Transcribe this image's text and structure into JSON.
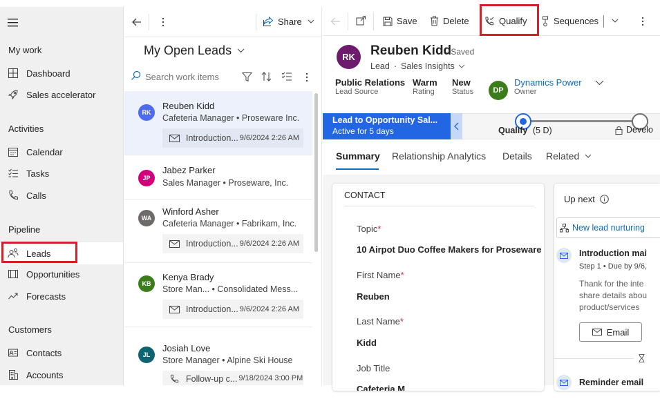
{
  "nav": {
    "sections": [
      {
        "title": "My work",
        "items": [
          {
            "label": "Dashboard",
            "icon": "dashboard-icon"
          },
          {
            "label": "Sales accelerator",
            "icon": "rocket-icon"
          }
        ]
      },
      {
        "title": "Activities",
        "items": [
          {
            "label": "Calendar",
            "icon": "calendar-icon"
          },
          {
            "label": "Tasks",
            "icon": "tasks-icon"
          },
          {
            "label": "Calls",
            "icon": "phone-icon"
          }
        ]
      },
      {
        "title": "Pipeline",
        "items": [
          {
            "label": "Leads",
            "icon": "leads-icon"
          },
          {
            "label": "Opportunities",
            "icon": "opportunities-icon"
          },
          {
            "label": "Forecasts",
            "icon": "forecast-icon"
          }
        ]
      },
      {
        "title": "Customers",
        "items": [
          {
            "label": "Contacts",
            "icon": "contact-card-icon"
          },
          {
            "label": "Accounts",
            "icon": "building-icon"
          }
        ]
      }
    ]
  },
  "list": {
    "share_label": "Share",
    "view_title": "My Open Leads",
    "search_placeholder": "Search work items",
    "leads": [
      {
        "initials": "RK",
        "color": "#4f6bed",
        "name": "Reuben Kidd",
        "subtitle": "Cafeteria Manager • Proseware Inc.",
        "activity_icon": "mail-icon",
        "activity": "Introduction...",
        "date": "9/6/2024 2:26 AM",
        "selected": true
      },
      {
        "initials": "JP",
        "color": "#d1007a",
        "name": "Jabez Parker",
        "subtitle": "Sales Manager • Proseware, Inc.",
        "activity": "",
        "date": ""
      },
      {
        "initials": "WA",
        "color": "#6e6a6a",
        "name": "Winford Asher",
        "subtitle": "Cafeteria Manager • Fabrikam, Inc.",
        "activity_icon": "mail-icon",
        "activity": "Introduction...",
        "date": "9/6/2024 2:26 AM"
      },
      {
        "initials": "KB",
        "color": "#3b7d1b",
        "name": "Kenya Brady",
        "subtitle": "Store Man...   • Consolidated Mess...",
        "activity_icon": "mail-icon",
        "activity": "Introduction...",
        "date": "9/6/2024 2:26 AM"
      },
      {
        "initials": "JL",
        "color": "#0e6472",
        "name": "Josiah Love",
        "subtitle": "Store Manager • Alpine Ski House",
        "activity_icon": "phone-icon",
        "activity": "Follow-up c...",
        "date": "9/18/2024 3:00 PM"
      }
    ]
  },
  "toolbar": {
    "save": "Save",
    "delete": "Delete",
    "qualify": "Qualify",
    "sequences": "Sequences"
  },
  "record": {
    "initials": "RK",
    "avatar_color": "#6e1b6e",
    "name": "Reuben Kidd",
    "saved": "- Saved",
    "entity": "Lead",
    "form": "Sales Insights",
    "fields": [
      {
        "value": "Public Relations",
        "label": "Lead Source"
      },
      {
        "value": "Warm",
        "label": "Rating"
      },
      {
        "value": "New",
        "label": "Status"
      }
    ],
    "owner": {
      "initials": "DP",
      "color": "#3b7d1b",
      "name": "Dynamics Power",
      "label": "Owner"
    }
  },
  "bpf": {
    "title": "Lead to Opportunity Sal...",
    "subtitle": "Active for 5 days",
    "stage1": "Qualify",
    "stage1_days": "(5 D)",
    "stage2": "Develo"
  },
  "tabs": [
    "Summary",
    "Relationship Analytics",
    "Details",
    "Related"
  ],
  "contact": {
    "header": "CONTACT",
    "topic_label": "Topic",
    "topic": "10 Airpot Duo Coffee Makers for Proseware",
    "first_label": "First Name",
    "first": "Reuben",
    "last_label": "Last Name",
    "last": "Kidd",
    "job_label": "Job Title",
    "job": "Cafeteria M..."
  },
  "upnext": {
    "title": "Up next",
    "sequence": "New lead nurturing",
    "act_title": "Introduction mai",
    "act_step": "Step 1 • Due by 9/6,",
    "act_body1": "Thank for the inte",
    "act_body2": "share details abou",
    "act_body3": "product/services",
    "email_btn": "Email",
    "reminder": "Reminder email"
  }
}
